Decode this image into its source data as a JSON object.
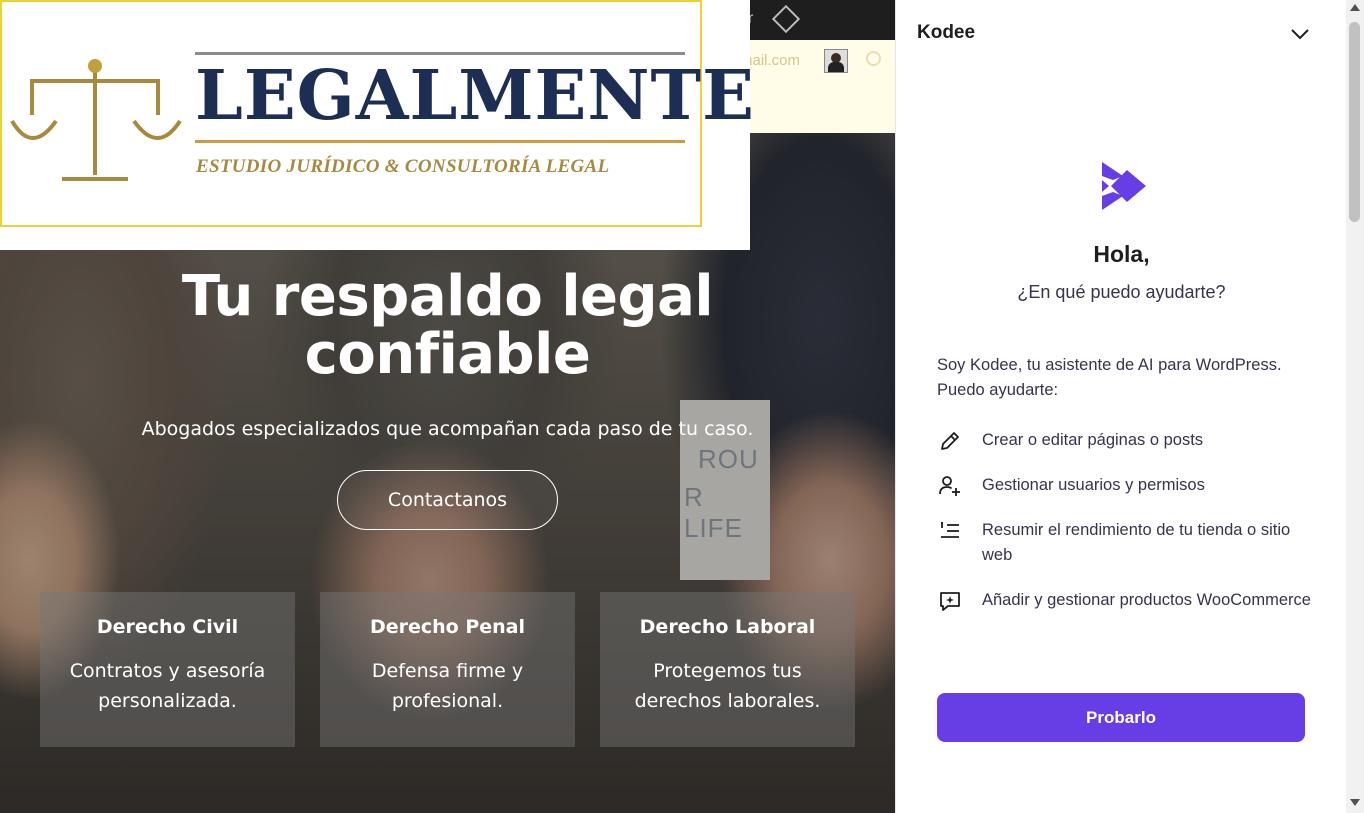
{
  "site": {
    "logo": {
      "title": "LEGALMENTE",
      "subtitle": "ESTUDIO JURÍDICO & CONSULTORÍA LEGAL"
    },
    "topbar": {
      "partial_letter": "r"
    },
    "contact": {
      "email_fragment": "mail.com"
    },
    "hero": {
      "title_line1": "Tu respaldo legal",
      "title_line2": "confiable",
      "subtitle": "Abogados especializados que acompañan cada paso de tu caso.",
      "cta": "Contactanos",
      "background_sign": [
        "ROU",
        "R LIFE"
      ]
    },
    "cards": [
      {
        "title": "Derecho Civil",
        "text": "Contratos y asesoría personalizada."
      },
      {
        "title": "Derecho Penal",
        "text": "Defensa firme y profesional."
      },
      {
        "title": "Derecho Laboral",
        "text": "Protegemos tus derechos laborales."
      }
    ]
  },
  "panel": {
    "title": "Kodee",
    "collapse_icon": "chevron-down-icon",
    "greeting": "Hola,",
    "question": "¿En qué puedo ayudarte?",
    "intro": "Soy Kodee, tu asistente de AI para WordPress. Puedo ayudarte:",
    "features": [
      {
        "icon": "pencil-icon",
        "text": "Crear o editar páginas o posts"
      },
      {
        "icon": "user-add-icon",
        "text": "Gestionar usuarios y permisos"
      },
      {
        "icon": "list-icon",
        "text": "Resumir el rendimiento de tu tienda o sitio web"
      },
      {
        "icon": "chat-sparkle-icon",
        "text": "Añadir y gestionar productos WooCommerce"
      }
    ],
    "button": "Probarlo"
  },
  "colors": {
    "accent": "#673de6",
    "logo_navy": "#1d2e55",
    "logo_gold": "#a7893f"
  }
}
